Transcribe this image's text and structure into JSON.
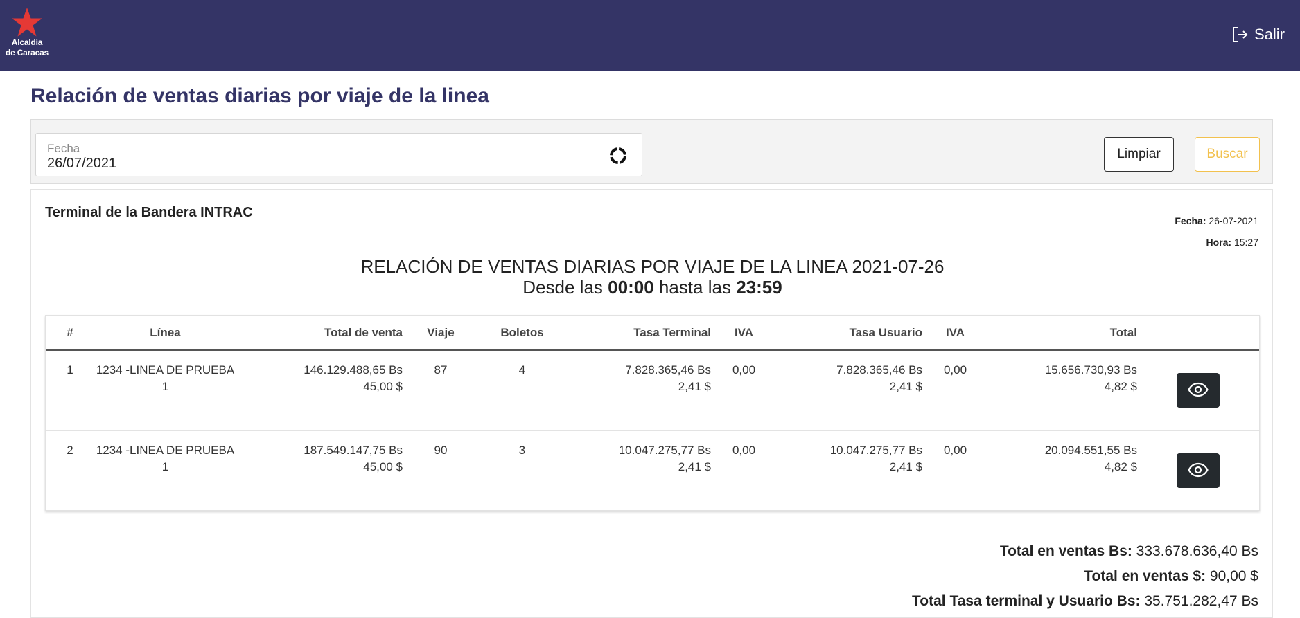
{
  "header": {
    "logo_line1": "Alcaldía",
    "logo_line2": "de Caracas",
    "logout_label": "Salir"
  },
  "page_title": "Relación de ventas diarias por viaje de la linea",
  "filter": {
    "date_label": "Fecha",
    "date_value": "26/07/2021",
    "clear_label": "Limpiar",
    "search_label": "Buscar"
  },
  "report": {
    "terminal": "Terminal de la Bandera INTRAC",
    "fecha_label": "Fecha:",
    "fecha_value": "26-07-2021",
    "hora_label": "Hora:",
    "hora_value": "15:27",
    "heading": "RELACIÓN DE VENTAS DIARIAS POR VIAJE DE LA LINEA 2021-07-26",
    "desde": "Desde las",
    "from_time": "00:00",
    "hasta": "hasta las",
    "to_time": "23:59"
  },
  "table": {
    "headers": [
      "#",
      "Línea",
      "Total de venta",
      "Viaje",
      "Boletos",
      "Tasa Terminal",
      "IVA",
      "Tasa Usuario",
      "IVA",
      "Total"
    ],
    "rows": [
      {
        "n": "1",
        "linea": "1234 -LINEA DE PRUEBA 1",
        "venta_bs": "146.129.488,65 Bs",
        "venta_usd": "45,00 $",
        "viaje": "87",
        "boletos": "4",
        "tasa_terminal_bs": "7.828.365,46 Bs",
        "tasa_terminal_usd": "2,41 $",
        "iva1": "0,00",
        "tasa_usuario_bs": "7.828.365,46 Bs",
        "tasa_usuario_usd": "2,41 $",
        "iva2": "0,00",
        "total_bs": "15.656.730,93 Bs",
        "total_usd": "4,82 $"
      },
      {
        "n": "2",
        "linea": "1234 -LINEA DE PRUEBA 1",
        "venta_bs": "187.549.147,75 Bs",
        "venta_usd": "45,00 $",
        "viaje": "90",
        "boletos": "3",
        "tasa_terminal_bs": "10.047.275,77 Bs",
        "tasa_terminal_usd": "2,41 $",
        "iva1": "0,00",
        "tasa_usuario_bs": "10.047.275,77 Bs",
        "tasa_usuario_usd": "2,41 $",
        "iva2": "0,00",
        "total_bs": "20.094.551,55 Bs",
        "total_usd": "4,82 $"
      }
    ]
  },
  "totals": {
    "ventas_bs_label": "Total en ventas Bs:",
    "ventas_bs_value": "333.678.636,40 Bs",
    "ventas_usd_label": "Total en ventas $:",
    "ventas_usd_value": "90,00 $",
    "tasa_label": "Total Tasa terminal y Usuario Bs:",
    "tasa_value": "35.751.282,47 Bs"
  },
  "colors": {
    "header_bg": "#343466",
    "title": "#343466",
    "search_accent": "#f2c14e",
    "logo_star": "#e53935"
  }
}
